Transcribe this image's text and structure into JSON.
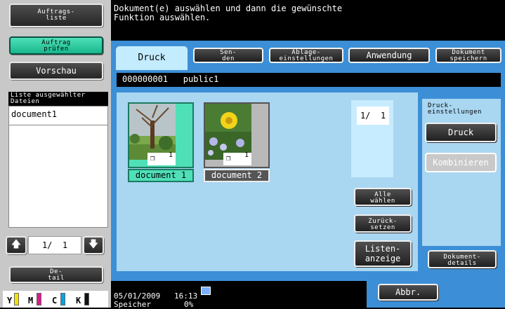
{
  "left": {
    "job_list_label": "Auftrags-\nliste",
    "check_job_label": "Auftrag\nprüfen",
    "preview_label": "Vorschau",
    "selected_files_header": "Liste ausgewählter\nDateien",
    "selected_files": [
      "document1"
    ],
    "page_indicator": "1/  1",
    "detail_label": "De-\ntail",
    "toner": [
      {
        "label": "Y",
        "color": "#f2e100"
      },
      {
        "label": "M",
        "color": "#d81b8c"
      },
      {
        "label": "C",
        "color": "#00a6e0"
      },
      {
        "label": "K",
        "color": "#111111"
      }
    ]
  },
  "header": {
    "message": "Dokument(e) auswählen und dann die gewünschte\nFunktion auswählen."
  },
  "tabs": [
    {
      "label": "Druck",
      "active": true
    },
    {
      "label": "Sen-\nden"
    },
    {
      "label": "Ablage-\neinstellungen"
    },
    {
      "label": "Anwendung"
    },
    {
      "label": "Dokument\nspeichern"
    }
  ],
  "path": {
    "box_number": "000000001",
    "box_name": "public1"
  },
  "documents": [
    {
      "name": "document 1",
      "pages": "1",
      "selected": true
    },
    {
      "name": "document 2",
      "pages": "1",
      "selected": false
    }
  ],
  "page_counter": "1/  1",
  "actions": {
    "select_all": "Alle\nwählen",
    "reset": "Zurück-\nsetzen",
    "list_view": "Listen-\nanzeige"
  },
  "print_settings": {
    "header": "Druck-\neinstellungen",
    "print_label": "Druck",
    "combine_label": "Kombinieren",
    "document_details_label": "Dokument-\ndetails"
  },
  "footer": {
    "date": "05/01/2009",
    "time": "16:13",
    "memory_label": "Speicher",
    "memory_value": "0%",
    "cancel_label": "Abbr."
  }
}
